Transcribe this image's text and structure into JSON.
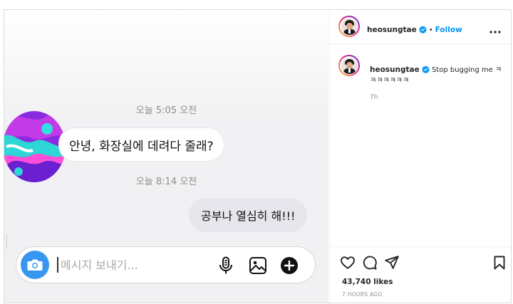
{
  "chat": {
    "timestamp_1": "오늘 5:05 오전",
    "incoming_message": "안녕, 화장실에 데려다 줄래?",
    "timestamp_2": "오늘 8:14 오전",
    "outgoing_message": "공부나 열심히 해!!!",
    "composer_placeholder": "메시지 보내기..."
  },
  "post": {
    "username": "heosungtae",
    "follow_label": "Follow",
    "caption_username": "heosungtae",
    "caption_text": "Stop bugging me ㅋㅋㅋㅋㅋㅋㅋ",
    "comment_age": "7h",
    "likes": "43,740 likes",
    "posted_ago": "7 HOURS AGO"
  },
  "icons": {
    "header": [
      "verified-badge-icon",
      "more-options-icon"
    ],
    "composer": [
      "camera-icon",
      "microphone-icon",
      "image-icon",
      "add-icon"
    ],
    "actions": [
      "heart-icon",
      "comment-icon",
      "share-icon",
      "bookmark-icon"
    ]
  },
  "colors": {
    "accent": "#0095f6",
    "camera_button": "#3797f0",
    "verified": "#0095f6"
  }
}
